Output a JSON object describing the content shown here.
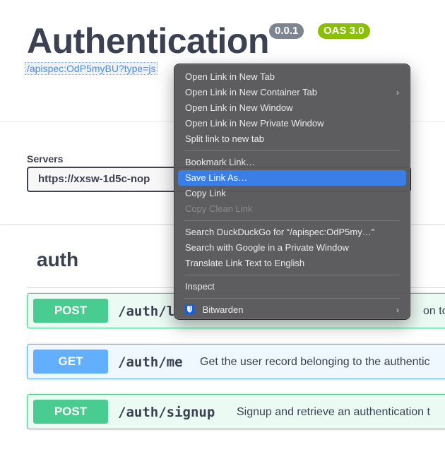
{
  "header": {
    "title": "Authentication",
    "version_badge": "0.0.1",
    "oas_badge": "OAS 3.0",
    "spec_link": "/apispec:OdP5myBU?type=js"
  },
  "servers": {
    "label": "Servers",
    "selected": "https://xxsw-1d5c-nop"
  },
  "tag": {
    "name": "auth"
  },
  "operations": [
    {
      "method": "POST",
      "path": "/auth/l",
      "summary": "on toke"
    },
    {
      "method": "GET",
      "path": "/auth/me",
      "summary": "Get the user record belonging to the authentic"
    },
    {
      "method": "POST",
      "path": "/auth/signup",
      "summary": "Signup and retrieve an authentication t"
    }
  ],
  "context_menu": {
    "group1": [
      "Open Link in New Tab",
      "Open Link in New Container Tab",
      "Open Link in New Window",
      "Open Link in New Private Window",
      "Split link to new tab"
    ],
    "group2": [
      "Bookmark Link…",
      "Save Link As…",
      "Copy Link",
      "Copy Clean Link"
    ],
    "group3": [
      "Search DuckDuckGo for “/apispec:OdP5my…”",
      "Search with Google in a Private Window",
      "Translate Link Text to English"
    ],
    "group4": [
      "Inspect"
    ],
    "group5": [
      "Bitwarden"
    ],
    "submenu_glyph": "›",
    "highlighted_item": "Save Link As…",
    "disabled_item": "Copy Clean Link",
    "icons": {
      "bitwarden": "bitwarden-shield-icon",
      "submenu": "chevron-right-icon"
    }
  },
  "colors": {
    "post": "#49cc90",
    "get": "#61affe",
    "highlight": "#3a7ee6",
    "version_badge": "#7d8492",
    "oas_badge": "#89bf04"
  }
}
